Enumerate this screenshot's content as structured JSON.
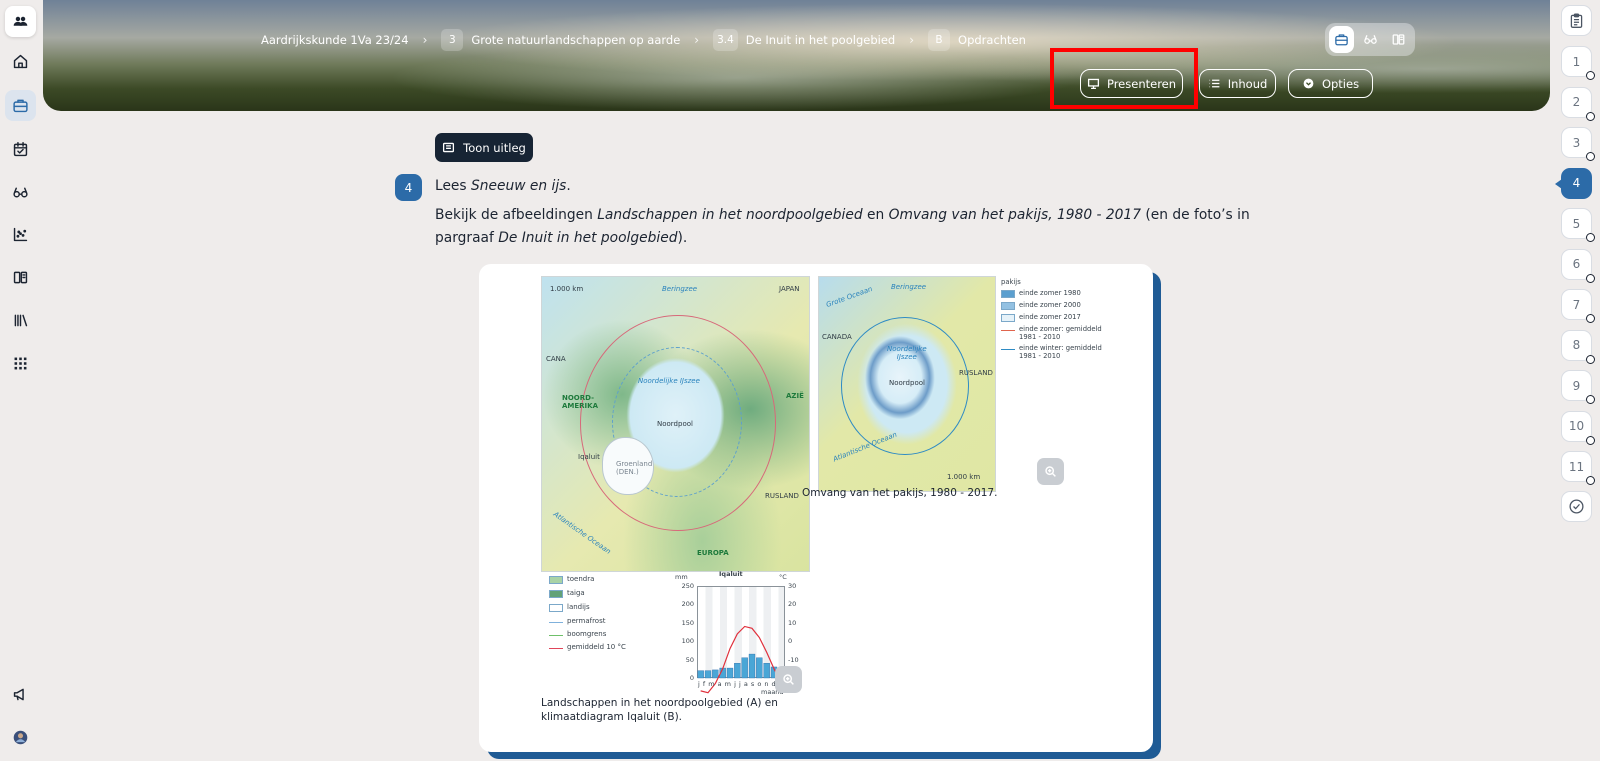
{
  "breadcrumb": {
    "course": "Aardrijkskunde 1Va 23/24",
    "chapter_num": "3",
    "chapter": "Grote natuurlandschappen op aarde",
    "section_num": "3.4",
    "section": "De Inuit in het poolgebied",
    "part_num": "B",
    "part": "Opdrachten"
  },
  "header": {
    "present_label": "Presenteren",
    "contents_label": "Inhoud",
    "options_label": "Opties"
  },
  "toon_uitleg": "Toon uitleg",
  "question": {
    "number": "4",
    "line1_prefix": "Lees ",
    "line1_title": "Sneeuw en ijs",
    "line1_suffix": ".",
    "line2_a": "Bekijk de afbeeldingen ",
    "line2_fig1": "Landschappen in het noordpoolgebied",
    "line2_b": " en ",
    "line2_fig2": "Omvang van het pakijs, 1980 - 2017",
    "line2_c": " (en de foto’s in",
    "line3_a": "pargraaf ",
    "line3_ref": "De Inuit in het poolgebied",
    "line3_b": ")."
  },
  "figure": {
    "map_a_labels": {
      "scale": "1.000 km",
      "beringzee": "Beringzee",
      "japan": "JAPAN",
      "canada": "CANA",
      "noord_amerika": "NOORD-\nAMERIKA",
      "noordelijke_ijszee": "Noordelijke IJszee",
      "azie": "AZIË",
      "noordpool": "Noordpool",
      "iqaluit": "Iqaluit",
      "groenland": "Groenland\n(DEN.)",
      "rusland": "RUSLAND",
      "atlantische": "Atlantische Oceaan",
      "europa": "EUROPA"
    },
    "map_b_labels": {
      "grote_oceaan": "Grote Oceaan",
      "beringzee": "Beringzee",
      "canada": "CANADA",
      "noordelijke_ijszee": "Noordelijke\nIJszee",
      "rusland": "RUSLAND",
      "noordpool": "Noordpool",
      "atlantische": "Atlantische Oceaan",
      "scale": "1.000 km"
    },
    "legend_b": {
      "title": "pakijs",
      "items": [
        {
          "label": "einde zomer 1980",
          "color": "#5b9fcf"
        },
        {
          "label": "einde zomer 2000",
          "color": "#93c1e2"
        },
        {
          "label": "einde zomer 2017",
          "color": "#e6f2f9"
        }
      ],
      "lines": [
        {
          "label": "einde zomer: gemiddeld 1981 - 2010",
          "color": "#e0644d"
        },
        {
          "label": "einde winter: gemiddeld 1981 - 2010",
          "color": "#2e8bc4"
        }
      ]
    },
    "legend_a": {
      "items": [
        {
          "label": "toendra",
          "color": "#a9d3a6"
        },
        {
          "label": "taiga",
          "color": "#62a277"
        },
        {
          "label": "landijs",
          "color": "#ffffff"
        }
      ],
      "lines": [
        {
          "label": "permafrost",
          "color": "#7fb1dc"
        },
        {
          "label": "boomgrens",
          "color": "#6fc06a"
        },
        {
          "label": "gemiddeld 10 °C",
          "color": "#e0455a"
        }
      ]
    },
    "climate": {
      "title": "Iqaluit",
      "unit_left": "mm",
      "unit_right": "°C",
      "months": "j f m a m j j a s o n d",
      "month_label": "maand",
      "left_ticks": [
        "250",
        "200",
        "150",
        "100",
        "50",
        "0"
      ],
      "right_ticks": [
        "30",
        "20",
        "10",
        "0",
        "-10",
        "-20"
      ]
    },
    "caption_b": "Omvang van het pakijs, 1980 - 2017.",
    "caption_a": "Landschappen in het noordpoolgebied (A) en klimaatdiagram Iqaluit (B)."
  },
  "chart_data": {
    "type": "bar",
    "title": "Iqaluit",
    "xlabel": "maand",
    "ylabel": "mm",
    "categories": [
      "j",
      "f",
      "m",
      "a",
      "m",
      "j",
      "j",
      "a",
      "s",
      "o",
      "n",
      "d"
    ],
    "series": [
      {
        "type": "bar",
        "values": [
          20,
          20,
          22,
          27,
          27,
          40,
          55,
          65,
          55,
          40,
          30,
          22
        ]
      },
      {
        "type": "line",
        "values": [
          -27,
          -28,
          -23,
          -15,
          -4,
          4,
          8,
          7,
          2,
          -6,
          -15,
          -23
        ]
      }
    ],
    "ylim": [
      0,
      250
    ],
    "y2lim": [
      -20,
      30
    ]
  },
  "questions": [
    "1",
    "2",
    "3",
    "4",
    "5",
    "6",
    "7",
    "8",
    "9",
    "10",
    "11"
  ],
  "active_question": "4"
}
